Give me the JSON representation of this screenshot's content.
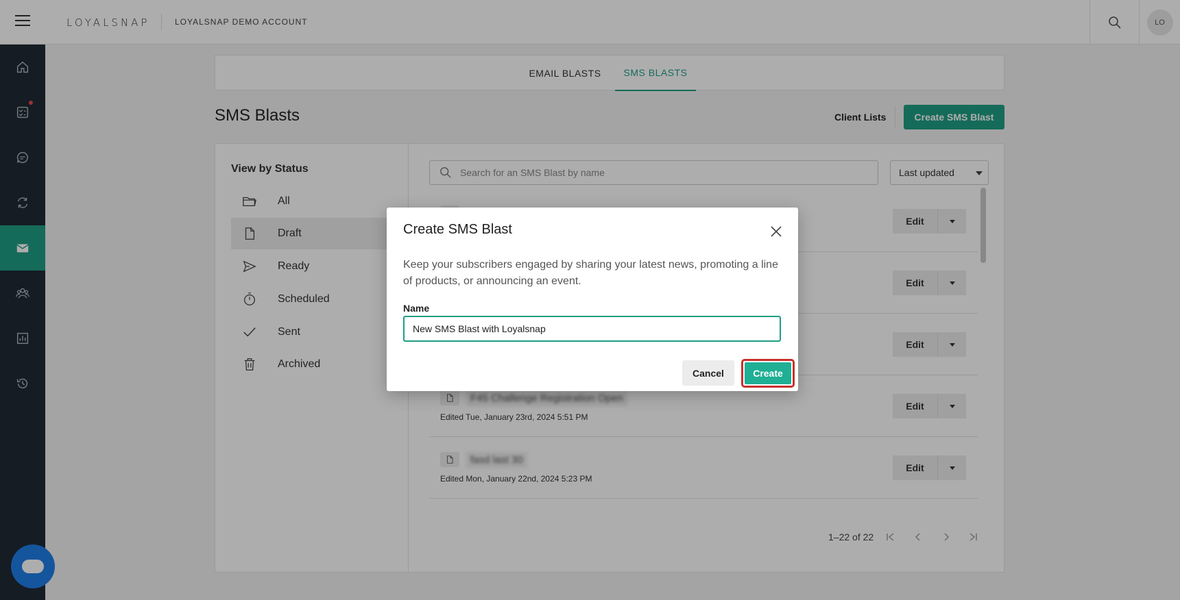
{
  "app": {
    "logo": "LOYALSNAP",
    "account": "LOYALSNAP DEMO ACCOUNT",
    "avatar_initials": "LO"
  },
  "sidebar": {
    "items": [
      {
        "icon": "home-icon"
      },
      {
        "icon": "tasks-icon",
        "has_notification": true
      },
      {
        "icon": "chat-icon"
      },
      {
        "icon": "refresh-icon"
      },
      {
        "icon": "mail-icon",
        "active": true
      },
      {
        "icon": "people-icon"
      },
      {
        "icon": "chart-icon"
      },
      {
        "icon": "history-icon"
      }
    ]
  },
  "tabs": [
    {
      "label": "EMAIL BLASTS",
      "active": false
    },
    {
      "label": "SMS BLASTS",
      "active": true
    }
  ],
  "header": {
    "title": "SMS Blasts",
    "client_lists": "Client Lists",
    "create_button": "Create SMS Blast"
  },
  "status_filter": {
    "title": "View by Status",
    "items": [
      {
        "label": "All",
        "icon": "folder-icon"
      },
      {
        "label": "Draft",
        "icon": "document-icon",
        "active": true
      },
      {
        "label": "Ready",
        "icon": "send-icon"
      },
      {
        "label": "Scheduled",
        "icon": "timer-icon"
      },
      {
        "label": "Sent",
        "icon": "check-icon"
      },
      {
        "label": "Archived",
        "icon": "trash-icon"
      }
    ]
  },
  "list": {
    "search_placeholder": "Search for an SMS Blast by name",
    "sort_value": "Last updated",
    "edit_label": "Edit",
    "rows": [
      {
        "name": "",
        "meta": ""
      },
      {
        "name": "",
        "meta": ""
      },
      {
        "name": "",
        "meta": ""
      },
      {
        "name": "F45 Challenge Registration Open",
        "meta": "Edited Tue, January 23rd, 2024 5:51 PM"
      },
      {
        "name": "fasd last 30",
        "meta": "Edited Mon, January 22nd, 2024 5:23 PM"
      }
    ],
    "pagination": "1–22 of 22"
  },
  "modal": {
    "title": "Create SMS Blast",
    "description": "Keep your subscribers engaged by sharing your latest news, promoting a line of products, or announcing an event.",
    "name_label": "Name",
    "name_value": "New SMS Blast with Loyalsnap",
    "cancel_label": "Cancel",
    "create_label": "Create"
  },
  "colors": {
    "brand": "#1f9e83",
    "sidebar": "#1f2a36",
    "highlight": "#c8302b",
    "chat": "#1f7ee8"
  }
}
